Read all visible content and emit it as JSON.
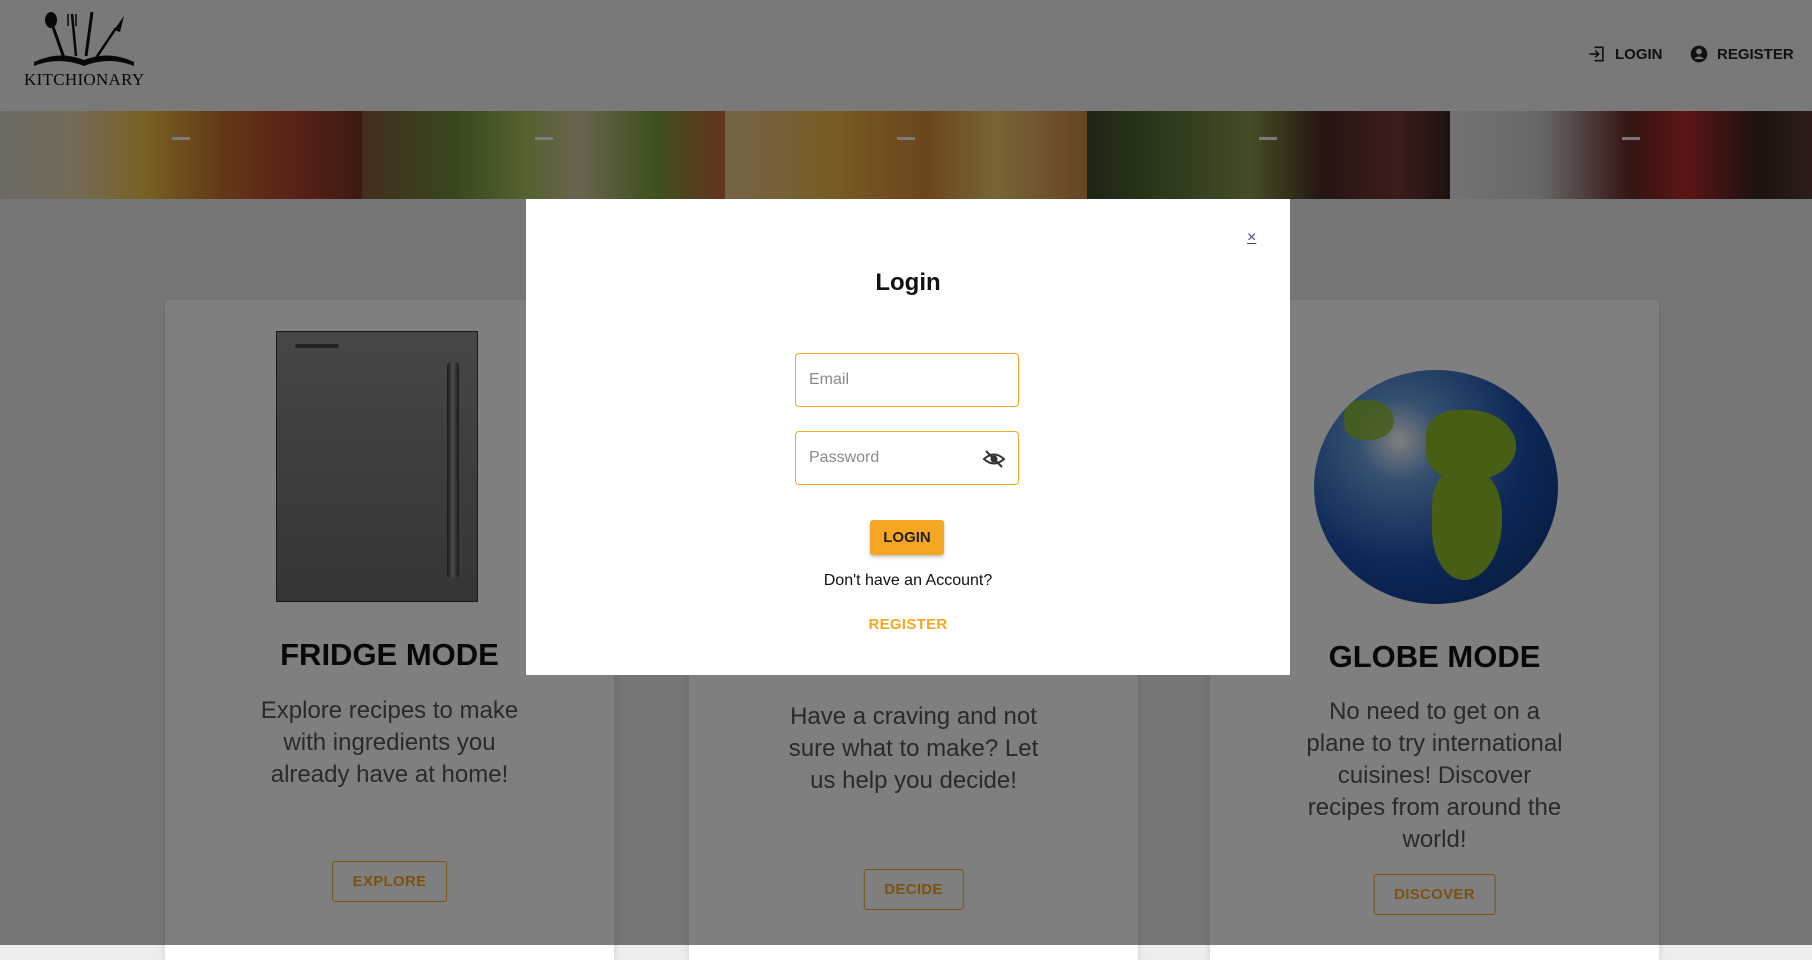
{
  "header": {
    "logo_text": "KITCHIONARY",
    "nav": {
      "login_label": "LOGIN",
      "register_label": "REGISTER"
    }
  },
  "cards": [
    {
      "title": "FRIDGE MODE",
      "description": "Explore recipes to make with ingredients you already have at home!",
      "button": "EXPLORE"
    },
    {
      "title": "",
      "description": "Have a craving and not sure what to make? Let us help you decide!",
      "button": "DECIDE"
    },
    {
      "title": "GLOBE MODE",
      "description": "No need to get on a plane to try international cuisines! Discover recipes from around the world!",
      "button": "DISCOVER"
    }
  ],
  "modal": {
    "close": "×",
    "title": "Login",
    "email_placeholder": "Email",
    "password_placeholder": "Password",
    "login_button": "LOGIN",
    "account_text": "Don't have an Account?",
    "register_link": "REGISTER"
  },
  "colors": {
    "accent": "#f5a623",
    "header_bg": "#f2f2f2",
    "overlay": "rgba(0,0,0,0.5)"
  },
  "icons": {
    "login": "login-icon",
    "register": "account-circle-icon",
    "password_visibility": "eye-off-icon"
  }
}
